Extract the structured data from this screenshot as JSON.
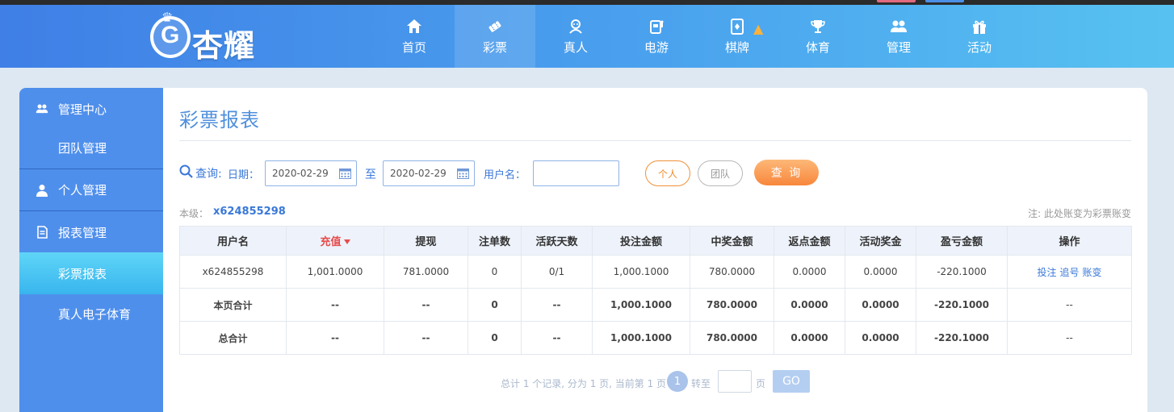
{
  "header": {
    "brand": "杏耀",
    "nav": [
      {
        "label": "首页",
        "icon": "home-icon"
      },
      {
        "label": "彩票",
        "icon": "ticket-icon",
        "active": true
      },
      {
        "label": "真人",
        "icon": "dealer-icon"
      },
      {
        "label": "电游",
        "icon": "slot-machine-icon"
      },
      {
        "label": "棋牌",
        "icon": "card-icon",
        "badge": "fire-icon"
      },
      {
        "label": "体育",
        "icon": "trophy-icon"
      },
      {
        "label": "管理",
        "icon": "users-icon"
      },
      {
        "label": "活动",
        "icon": "gift-icon"
      }
    ]
  },
  "sidebar": {
    "items": [
      {
        "label": "管理中心",
        "icon": "users-icon",
        "type": "section"
      },
      {
        "label": "团队管理",
        "type": "sub"
      },
      {
        "label": "个人管理",
        "icon": "person-icon",
        "type": "section"
      },
      {
        "label": "报表管理",
        "icon": "document-icon",
        "type": "section"
      },
      {
        "label": "彩票报表",
        "type": "sub",
        "active": true
      },
      {
        "label": "真人电子体育",
        "type": "sub"
      }
    ]
  },
  "main": {
    "title": "彩票报表",
    "query": {
      "label": "查询:",
      "date_label": "日期：",
      "start_date": "2020-02-29",
      "to_label": "至",
      "end_date": "2020-02-29",
      "username_label": "用户名：",
      "username_value": "",
      "personal_label": "个人",
      "team_label": "团队",
      "search_label": "查 询"
    },
    "level_label": "本级：",
    "level_value": "x624855298",
    "note": "注: 此处账变为彩票账变",
    "table": {
      "headers": [
        "用户名",
        "充值",
        "提现",
        "注单数",
        "活跃天数",
        "投注金额",
        "中奖金额",
        "返点金额",
        "活动奖金",
        "盈亏金额",
        "操作"
      ],
      "rows": [
        [
          "x624855298",
          "1,001.0000",
          "781.0000",
          "0",
          "0/1",
          "1,000.1000",
          "780.0000",
          "0.0000",
          "0.0000",
          "-220.1000"
        ],
        [
          "本页合计",
          "--",
          "--",
          "0",
          "--",
          "1,000.1000",
          "780.0000",
          "0.0000",
          "0.0000",
          "-220.1000",
          "--"
        ],
        [
          "总合计",
          "--",
          "--",
          "0",
          "--",
          "1,000.1000",
          "780.0000",
          "0.0000",
          "0.0000",
          "-220.1000",
          "--"
        ]
      ],
      "ops": [
        "投注",
        "追号",
        "账变"
      ]
    },
    "pager": {
      "summary": "总计 1 个记录, 分为 1 页, 当前第 1 页",
      "current": "1",
      "goto_label": "转至",
      "page_label": "页",
      "go_label": "GO"
    }
  },
  "colors": {
    "header_start": "#3f7fe6",
    "header_end": "#57c2f1",
    "sidebar": "#4f8fec",
    "sidebar_active": "#38b5ee",
    "accent_orange": "#f7873c",
    "negative": "#e02d2d",
    "link": "#3a78d8"
  }
}
